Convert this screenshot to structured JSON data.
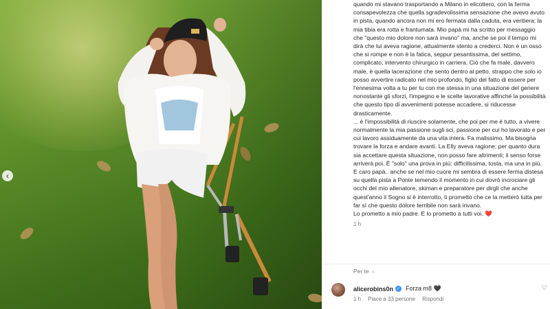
{
  "caption": {
    "text": "quando mi stavano trasportando a Milano in elicottero, con la ferma consapevolezza che quella sgradevolissima sensazione che avevo avuto in pista, quando ancora non mi ero fermata dalla caduta, era veritiera: la mia tibia era rotta e frantumata. Mio papà mi ha scritto per messaggio che \"questo mio dolore non sarà invano\" ma, anche se poi il tempo mi dirà che lui aveva ragione, attualmente stento a crederci. Non è un osso che si rompe e non è la fatica, seppur pesantissima, del settimo, complicato, intervento chirurgico in carriera. Ciò che fa male, davvero male, è quella lacerazione che sento dentro al petto, strappo che solo io posso avvertire radicato nel mio profondo, figlio del fatto di essere per l'ennesima volta a tu per tu con me stessa in una situazione del genere nonostante gli sforzi, l'impegno e le scelte lavorative affinché la possibilità che questo tipo di avvenimenti potesse accadere, si riducesse drasticamente.\n... è l'impossibilità di riuscire solamente, che poi per me è tutto, a vivere normalmente la mia passione sugli sci, passione per cui ho lavorato e per cui lavoro assiduamente da una vita intera. Fa malissimo. Ma bisogna trovare la forza e andare avanti. La Elly aveva ragione: per quanto dura sia accettare questa situazione, non posso fare altrimenti; il senso forse arriverà poi. È \"solo\" una prova in più: difficilissima, tosta, ma una in più.\nE caro papà.. anche se nel mio cuore mi sembra di essere ferma distesa su quella pista a Ponte temendo il momento in cui dovrò incrociare gli occhi del mio allenatore, skiman e preparatore per dirgli che anche quest'anno il Sogno si è interrotto, ti prometto che ce la metterò tutta per far sì che questo dolore terribile non sarà invano.\nLo prometto a mio padre. E lo prometto a tutti voi.",
    "heart": "❤️",
    "age": "1 h"
  },
  "for_you": {
    "label": "Per te",
    "chevron": "⌄"
  },
  "comment": {
    "user": "alicerobins0n",
    "verified_icon": "✓",
    "text": "Forza m8 🖤",
    "age": "1 h",
    "likes": "Piace a 33 persone",
    "reply": "Rispondi",
    "heart": "♡"
  },
  "carousel": {
    "prev_icon": "‹"
  },
  "colors": {
    "accent_blue": "#3897f0",
    "heart_red": "#ed4956",
    "secondary_text": "#737373"
  }
}
